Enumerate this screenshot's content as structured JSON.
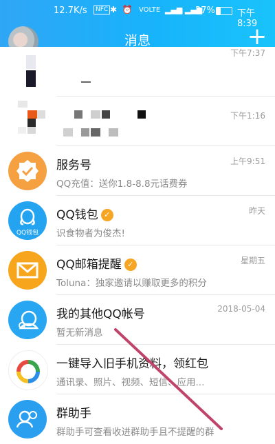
{
  "status_bar": {
    "speed": "12.7K/s",
    "nfc": "NFC",
    "volte": "VOLTE",
    "battery": "27%",
    "battery_level": 0.27,
    "time": "下午8:39"
  },
  "header": {
    "title": "消息",
    "add_label": "+"
  },
  "conversations": [
    {
      "name": "",
      "preview": "",
      "time": "下午7:37"
    },
    {
      "name": "",
      "preview": "",
      "time": "下午1:16"
    },
    {
      "name": "服务号",
      "preview": "QQ充值：送你1.8-8.8元话费券",
      "time": "上午9:51",
      "icon": "service-account-icon"
    },
    {
      "name": "QQ钱包",
      "preview": "识食物者为俊杰!",
      "time": "昨天",
      "icon": "qq-wallet-icon",
      "icon_text": "QQ钱包"
    },
    {
      "name": "QQ邮箱提醒",
      "preview": "Toluna：独家邀请以赚取更多的积分",
      "time": "星期五",
      "icon": "mail-icon"
    },
    {
      "name": "我的其他QQ帐号",
      "preview": "暂无新消息",
      "time": "2018-05-04",
      "icon": "other-accounts-icon"
    },
    {
      "name": "一键导入旧手机资料，领红包",
      "preview": "通讯录、照片、视频、短信、应用...",
      "time": "",
      "icon": "import-data-icon"
    },
    {
      "name": "群助手",
      "preview": "群助手可查看收进群助手且不提醒的群",
      "time": "",
      "icon": "group-assistant-icon"
    }
  ],
  "colors": {
    "header_start": "#2fa6f6",
    "header_end": "#19c3fb",
    "service_orange": "#f5a142",
    "wallet_blue": "#24a3f0",
    "mail_orange": "#f7a51c",
    "other_blue": "#28a6f1",
    "verify": "#f6a623",
    "annotation_arrow": "#c0436a"
  }
}
